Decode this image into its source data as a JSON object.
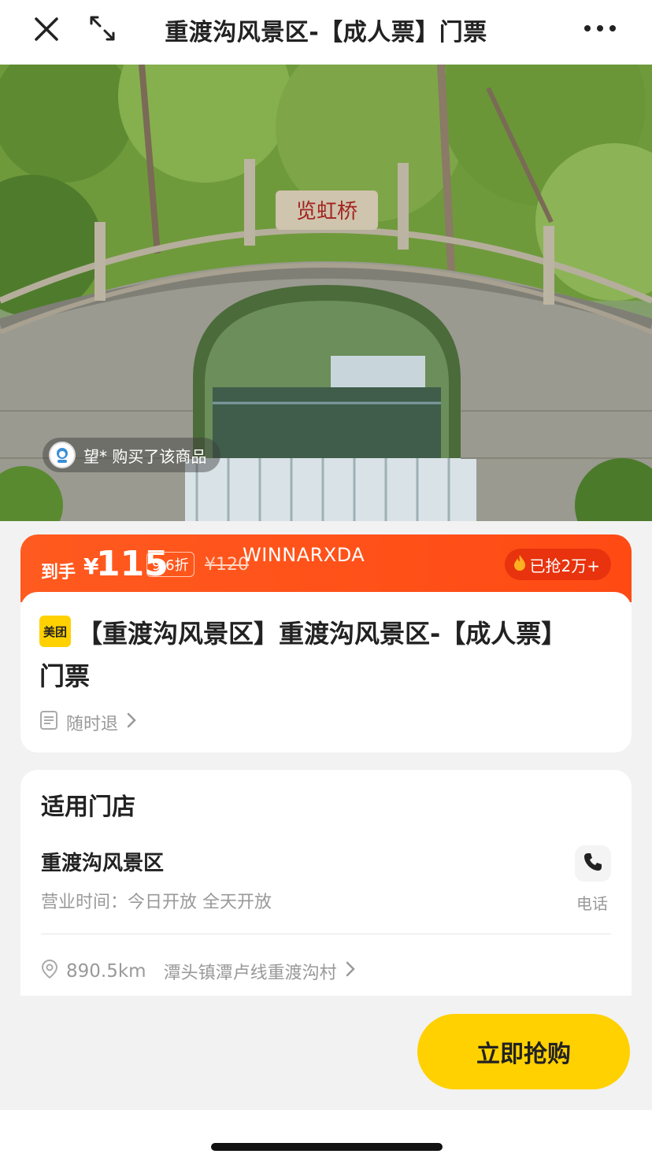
{
  "topbar": {
    "title": "重渡沟风景区-【成人票】门票",
    "close_icon": "close-icon",
    "expand_icon": "expand-icon",
    "more_icon": "more-icon"
  },
  "hero": {
    "image_desc_icon": "bridge-photo",
    "buyer_tip": "望* 购买了该商品"
  },
  "price": {
    "prefix": "到手",
    "currency": "¥",
    "value": "115",
    "discount": "9.6折",
    "original": "¥120",
    "watermark": "WINNARXDA",
    "grabbed": "已抢2万+"
  },
  "product": {
    "brand": "美团",
    "title": "【重渡沟风景区】重渡沟风景区-【成人票】门票",
    "refund": "随时退"
  },
  "store": {
    "heading": "适用门店",
    "name": "重渡沟风景区",
    "hours": "营业时间：今日开放 全天开放",
    "call_label": "电话",
    "distance": "890.5km",
    "address": "潭头镇潭卢线重渡沟村"
  },
  "cta": {
    "buy_label": "立即抢购"
  },
  "colors": {
    "price_band": "#ff4a14",
    "buy_button": "#ffd100",
    "brand_badge": "#ffd100"
  }
}
